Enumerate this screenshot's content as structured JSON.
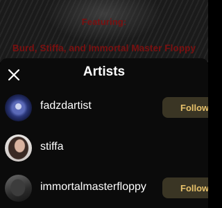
{
  "background_poster": {
    "line1": "Featuring:",
    "line2": "Burd, Stiffa, and Immortal Master Floppy"
  },
  "sheet": {
    "title": "Artists",
    "close_icon": "close-icon"
  },
  "artists": [
    {
      "name": "fadzdartist",
      "follow_label": "Follow",
      "show_follow": true
    },
    {
      "name": "stiffa",
      "follow_label": "",
      "show_follow": false
    },
    {
      "name": "immortalmasterfloppy",
      "follow_label": "Follow",
      "show_follow": true
    }
  ],
  "colors": {
    "accent_text": "#e7c16a",
    "follow_button_bg": "#3a3524",
    "poster_text": "#7a1010"
  }
}
